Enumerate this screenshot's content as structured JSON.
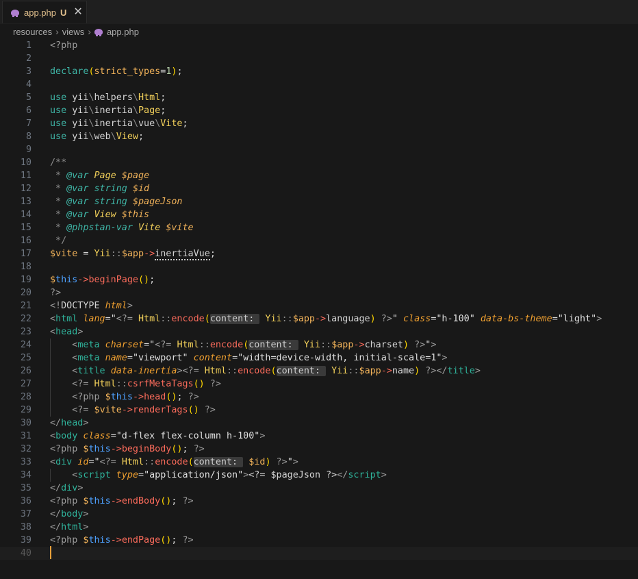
{
  "tab": {
    "file_name": "app.php",
    "status": "U",
    "close_glyph": "✕",
    "icon": "php-elephant-icon"
  },
  "breadcrumb": {
    "segments": [
      "resources",
      "views",
      "app.php"
    ],
    "separator": "›"
  },
  "editor": {
    "cursor_line": 40,
    "line_numbers": [
      "1",
      "2",
      "3",
      "4",
      "5",
      "6",
      "7",
      "8",
      "9",
      "10",
      "11",
      "12",
      "13",
      "14",
      "15",
      "16",
      "17",
      "18",
      "19",
      "20",
      "21",
      "22",
      "23",
      "24",
      "25",
      "26",
      "27",
      "28",
      "29",
      "30",
      "31",
      "32",
      "33",
      "34",
      "35",
      "36",
      "37",
      "38",
      "39",
      "40"
    ],
    "lines": [
      [
        [
          "<?php",
          "php"
        ]
      ],
      [],
      [
        [
          "declare",
          "k"
        ],
        [
          "(",
          "par"
        ],
        [
          "strict_types",
          "var"
        ],
        [
          "=",
          ""
        ],
        [
          "1",
          "num"
        ],
        [
          ")",
          "par"
        ],
        [
          ";",
          ""
        ]
      ],
      [],
      [
        [
          "use ",
          "k"
        ],
        [
          "yii",
          ""
        ],
        [
          "\\",
          "cm"
        ],
        [
          "helpers",
          ""
        ],
        [
          "\\",
          "cm"
        ],
        [
          "Html",
          "cls"
        ],
        [
          ";",
          ""
        ]
      ],
      [
        [
          "use ",
          "k"
        ],
        [
          "yii",
          ""
        ],
        [
          "\\",
          "cm"
        ],
        [
          "inertia",
          ""
        ],
        [
          "\\",
          "cm"
        ],
        [
          "Page",
          "cls"
        ],
        [
          ";",
          ""
        ]
      ],
      [
        [
          "use ",
          "k"
        ],
        [
          "yii",
          ""
        ],
        [
          "\\",
          "cm"
        ],
        [
          "inertia",
          ""
        ],
        [
          "\\",
          "cm"
        ],
        [
          "vue",
          ""
        ],
        [
          "\\",
          "cm"
        ],
        [
          "Vite",
          "cls"
        ],
        [
          ";",
          ""
        ]
      ],
      [
        [
          "use ",
          "k"
        ],
        [
          "yii",
          ""
        ],
        [
          "\\",
          "cm"
        ],
        [
          "web",
          ""
        ],
        [
          "\\",
          "cm"
        ],
        [
          "View",
          "cls"
        ],
        [
          ";",
          ""
        ]
      ],
      [],
      [
        [
          "/**",
          "cm"
        ]
      ],
      [
        [
          " * ",
          "cm"
        ],
        [
          "@var ",
          "k ital"
        ],
        [
          "Page ",
          "cls ital"
        ],
        [
          "$page",
          "var ital"
        ]
      ],
      [
        [
          " * ",
          "cm"
        ],
        [
          "@var ",
          "k ital"
        ],
        [
          "string ",
          "k ital"
        ],
        [
          "$id",
          "var ital"
        ]
      ],
      [
        [
          " * ",
          "cm"
        ],
        [
          "@var ",
          "k ital"
        ],
        [
          "string ",
          "k ital"
        ],
        [
          "$pageJson",
          "var ital"
        ]
      ],
      [
        [
          " * ",
          "cm"
        ],
        [
          "@var ",
          "k ital"
        ],
        [
          "View ",
          "cls ital"
        ],
        [
          "$this",
          "var ital"
        ]
      ],
      [
        [
          " * ",
          "cm"
        ],
        [
          "@phpstan-var ",
          "k ital"
        ],
        [
          "Vite ",
          "cls ital"
        ],
        [
          "$vite",
          "var ital"
        ]
      ],
      [
        [
          " */",
          "cm"
        ]
      ],
      [
        [
          "$",
          "var"
        ],
        [
          "vite",
          "var"
        ],
        [
          " = ",
          ""
        ],
        [
          "Yii",
          "cls"
        ],
        [
          "::",
          "cm"
        ],
        [
          "$",
          "var"
        ],
        [
          "app",
          "var"
        ],
        [
          "->",
          "fn"
        ],
        [
          "inertiaVue",
          "dot"
        ],
        [
          ";",
          ""
        ]
      ],
      [],
      [
        [
          "$",
          "var"
        ],
        [
          "this",
          "this"
        ],
        [
          "->",
          "fn"
        ],
        [
          "beginPage",
          "fn"
        ],
        [
          "()",
          "par"
        ],
        [
          ";",
          ""
        ]
      ],
      [
        [
          "?>",
          "php"
        ]
      ],
      [
        [
          "<!",
          "br"
        ],
        [
          "DOCTYPE ",
          ""
        ],
        [
          "html",
          "attr"
        ],
        [
          ">",
          "br"
        ]
      ],
      [
        [
          "<",
          "br"
        ],
        [
          "html ",
          "tag"
        ],
        [
          "lang",
          "attr"
        ],
        [
          "=",
          ""
        ],
        [
          "\"",
          "str"
        ],
        [
          "<?= ",
          "php"
        ],
        [
          "Html",
          "cls"
        ],
        [
          "::",
          "cm"
        ],
        [
          "encode",
          "fn"
        ],
        [
          "(",
          "par"
        ],
        [
          "content: ",
          "hint"
        ],
        [
          " Yii",
          "cls"
        ],
        [
          "::",
          "cm"
        ],
        [
          "$",
          "var"
        ],
        [
          "app",
          "var"
        ],
        [
          "->",
          "fn"
        ],
        [
          "language",
          ""
        ],
        [
          ")",
          "par"
        ],
        [
          " ?>",
          "php"
        ],
        [
          "\" ",
          "str"
        ],
        [
          "class",
          "attr"
        ],
        [
          "=",
          ""
        ],
        [
          "\"h-100\" ",
          "str"
        ],
        [
          "data-bs-theme",
          "attr"
        ],
        [
          "=",
          ""
        ],
        [
          "\"light\"",
          "str"
        ],
        [
          ">",
          "br"
        ]
      ],
      [
        [
          "<",
          "br"
        ],
        [
          "head",
          "tag"
        ],
        [
          ">",
          "br"
        ]
      ],
      [
        [
          "    <",
          "br"
        ],
        [
          "meta ",
          "tag"
        ],
        [
          "charset",
          "attr"
        ],
        [
          "=",
          ""
        ],
        [
          "\"",
          "str"
        ],
        [
          "<?= ",
          "php"
        ],
        [
          "Html",
          "cls"
        ],
        [
          "::",
          "cm"
        ],
        [
          "encode",
          "fn"
        ],
        [
          "(",
          "par"
        ],
        [
          "content: ",
          "hint"
        ],
        [
          " Yii",
          "cls"
        ],
        [
          "::",
          "cm"
        ],
        [
          "$",
          "var"
        ],
        [
          "app",
          "var"
        ],
        [
          "->",
          "fn"
        ],
        [
          "charset",
          ""
        ],
        [
          ")",
          "par"
        ],
        [
          " ?>",
          "php"
        ],
        [
          "\"",
          "str"
        ],
        [
          ">",
          "br"
        ]
      ],
      [
        [
          "    <",
          "br"
        ],
        [
          "meta ",
          "tag"
        ],
        [
          "name",
          "attr"
        ],
        [
          "=",
          ""
        ],
        [
          "\"viewport\" ",
          "str"
        ],
        [
          "content",
          "attr"
        ],
        [
          "=",
          ""
        ],
        [
          "\"width=device-width, initial-scale=1\"",
          "str"
        ],
        [
          ">",
          "br"
        ]
      ],
      [
        [
          "    <",
          "br"
        ],
        [
          "title ",
          "tag"
        ],
        [
          "data-inertia",
          "attr"
        ],
        [
          ">",
          "br"
        ],
        [
          "<?= ",
          "php"
        ],
        [
          "Html",
          "cls"
        ],
        [
          "::",
          "cm"
        ],
        [
          "encode",
          "fn"
        ],
        [
          "(",
          "par"
        ],
        [
          "content: ",
          "hint"
        ],
        [
          " Yii",
          "cls"
        ],
        [
          "::",
          "cm"
        ],
        [
          "$",
          "var"
        ],
        [
          "app",
          "var"
        ],
        [
          "->",
          "fn"
        ],
        [
          "name",
          ""
        ],
        [
          ")",
          "par"
        ],
        [
          " ?>",
          "php"
        ],
        [
          "</",
          "br"
        ],
        [
          "title",
          "tag"
        ],
        [
          ">",
          "br"
        ]
      ],
      [
        [
          "    <?= ",
          "php"
        ],
        [
          "Html",
          "cls"
        ],
        [
          "::",
          "cm"
        ],
        [
          "csrfMetaTags",
          "fn"
        ],
        [
          "()",
          "par"
        ],
        [
          " ?>",
          "php"
        ]
      ],
      [
        [
          "    <?php ",
          "php"
        ],
        [
          "$",
          "var"
        ],
        [
          "this",
          "this"
        ],
        [
          "->",
          "fn"
        ],
        [
          "head",
          "fn"
        ],
        [
          "()",
          "par"
        ],
        [
          "; ",
          ""
        ],
        [
          "?>",
          "php"
        ]
      ],
      [
        [
          "    <?= ",
          "php"
        ],
        [
          "$",
          "var"
        ],
        [
          "vite",
          "var"
        ],
        [
          "->",
          "fn"
        ],
        [
          "renderTags",
          "fn"
        ],
        [
          "()",
          "par"
        ],
        [
          " ?>",
          "php"
        ]
      ],
      [
        [
          "</",
          "br"
        ],
        [
          "head",
          "tag"
        ],
        [
          ">",
          "br"
        ]
      ],
      [
        [
          "<",
          "br"
        ],
        [
          "body ",
          "tag"
        ],
        [
          "class",
          "attr"
        ],
        [
          "=",
          ""
        ],
        [
          "\"d-flex flex-column h-100\"",
          "str"
        ],
        [
          ">",
          "br"
        ]
      ],
      [
        [
          "<?php ",
          "php"
        ],
        [
          "$",
          "var"
        ],
        [
          "this",
          "this"
        ],
        [
          "->",
          "fn"
        ],
        [
          "beginBody",
          "fn"
        ],
        [
          "()",
          "par"
        ],
        [
          "; ",
          ""
        ],
        [
          "?>",
          "php"
        ]
      ],
      [
        [
          "<",
          "br"
        ],
        [
          "div ",
          "tag"
        ],
        [
          "id",
          "attr"
        ],
        [
          "=",
          ""
        ],
        [
          "\"",
          "str"
        ],
        [
          "<?= ",
          "php"
        ],
        [
          "Html",
          "cls"
        ],
        [
          "::",
          "cm"
        ],
        [
          "encode",
          "fn"
        ],
        [
          "(",
          "par"
        ],
        [
          "content: ",
          "hint"
        ],
        [
          " $",
          "var"
        ],
        [
          "id",
          "var"
        ],
        [
          ")",
          "par"
        ],
        [
          " ?>",
          "php"
        ],
        [
          "\"",
          "str"
        ],
        [
          ">",
          "br"
        ]
      ],
      [
        [
          "    <",
          "br"
        ],
        [
          "script ",
          "tag"
        ],
        [
          "type",
          "attr"
        ],
        [
          "=",
          ""
        ],
        [
          "\"application/json\"",
          "str"
        ],
        [
          ">",
          "br"
        ],
        [
          "<?= ",
          ""
        ],
        [
          "$pageJson ",
          ""
        ],
        [
          "?>",
          ""
        ],
        [
          "</",
          "br"
        ],
        [
          "script",
          "tag"
        ],
        [
          ">",
          "br"
        ]
      ],
      [
        [
          "</",
          "br"
        ],
        [
          "div",
          "tag"
        ],
        [
          ">",
          "br"
        ]
      ],
      [
        [
          "<?php ",
          "php"
        ],
        [
          "$",
          "var"
        ],
        [
          "this",
          "this"
        ],
        [
          "->",
          "fn"
        ],
        [
          "endBody",
          "fn"
        ],
        [
          "()",
          "par"
        ],
        [
          "; ",
          ""
        ],
        [
          "?>",
          "php"
        ]
      ],
      [
        [
          "</",
          "br"
        ],
        [
          "body",
          "tag"
        ],
        [
          ">",
          "br"
        ]
      ],
      [
        [
          "</",
          "br"
        ],
        [
          "html",
          "tag"
        ],
        [
          ">",
          "br"
        ]
      ],
      [
        [
          "<?php ",
          "php"
        ],
        [
          "$",
          "var"
        ],
        [
          "this",
          "this"
        ],
        [
          "->",
          "fn"
        ],
        [
          "endPage",
          "fn"
        ],
        [
          "()",
          "par"
        ],
        [
          "; ",
          ""
        ],
        [
          "?>",
          "php"
        ]
      ],
      []
    ]
  }
}
